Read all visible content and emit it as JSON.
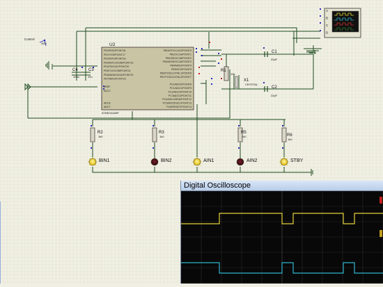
{
  "schematic": {
    "mcu": {
      "ref": "U2",
      "part": "ATMEGA328P",
      "left_pins": [
        "PD0/RXD/PCINT16",
        "PD1/TXD/PCINT17",
        "PD2/INT0/PCINT18",
        "PD3/INT1/OC2B/PCINT19",
        "PD4/T0/XCK/PCINT20",
        "PD5/T1/OC0B/PCINT21",
        "PD6/AIN0/OC0A/PCINT22",
        "PD7/AIN1/PCINT23",
        "",
        "AREF",
        "AVCC",
        "",
        "",
        "ADC6",
        "ADC7"
      ],
      "right_pins": [
        "PB0/ICP1/CLKO/PCINT0",
        "PB1/OC1A/PCINT1",
        "PB2/SS/OC1B/PCINT2",
        "PB3/MOSI/OC2A/PCINT3",
        "PB4/MISO/PCINT4",
        "PB5/SCK/PCINT5",
        "PB6/TOSC1/XTAL1/PCINT6",
        "PB7/TOSC2/XTAL2/PCINT7",
        "",
        "PC0/ADC0/PCINT8",
        "PC1/ADC1/PCINT9",
        "PC2/ADC2/PCINT10",
        "PC3/ADC3/PCINT11",
        "PC4/ADC4/SDA/PCINT12",
        "PC5/ADC5/SCL/PCINT13",
        "PC6/RESET/PCINT14"
      ]
    },
    "caps": [
      {
        "ref": "C4",
        "value": "100n"
      },
      {
        "ref": "C3",
        "value": "10n"
      },
      {
        "ref": "C1",
        "value": "22pF"
      },
      {
        "ref": "C2",
        "value": "22pF"
      }
    ],
    "crystal": {
      "ref": "X1",
      "value": "CRYSTAL"
    },
    "r1": {
      "ref": "R1",
      "value": "10k"
    },
    "resistors": [
      {
        "ref": "R2",
        "value": "1k0"
      },
      {
        "ref": "R3",
        "value": "1k0"
      },
      {
        "ref": "R5",
        "value": "1k0"
      },
      {
        "ref": "R6",
        "value": "1k0"
      }
    ],
    "leds": [
      {
        "label": "BIN1",
        "state": "on"
      },
      {
        "label": "BIN2",
        "state": "off"
      },
      {
        "label": "AIN1",
        "state": "on"
      },
      {
        "label": "AIN2",
        "state": "off"
      },
      {
        "label": "STBY",
        "state": "on"
      }
    ],
    "control_label": "Control",
    "control_value": "3000",
    "osc_channels": [
      "A",
      "B",
      "C",
      "D"
    ]
  },
  "scope": {
    "title": "Digital Oscilloscope",
    "colors": {
      "ch_a": "#e8d23a",
      "ch_b": "#2fb4cf",
      "grid": "#2a2a2a",
      "grid_center": "#3c3c3c"
    }
  }
}
